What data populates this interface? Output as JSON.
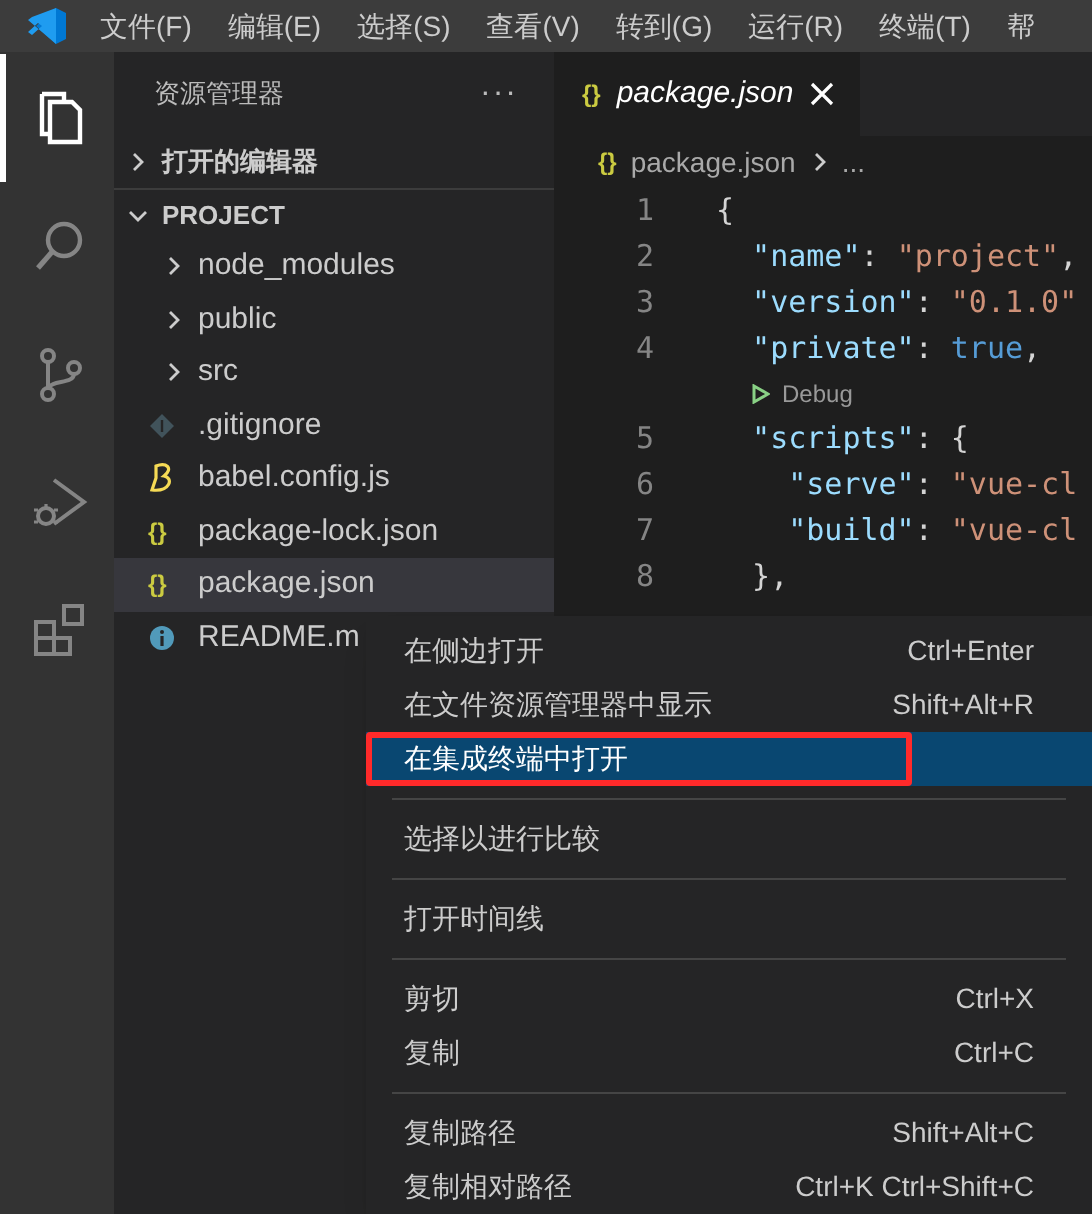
{
  "menu_bar": [
    {
      "label": "文件(F)"
    },
    {
      "label": "编辑(E)"
    },
    {
      "label": "选择(S)"
    },
    {
      "label": "查看(V)"
    },
    {
      "label": "转到(G)"
    },
    {
      "label": "运行(R)"
    },
    {
      "label": "终端(T)"
    },
    {
      "label": "帮"
    }
  ],
  "activity_bar": [
    {
      "kind": "files",
      "selected": true
    },
    {
      "kind": "search",
      "selected": false
    },
    {
      "kind": "source-control",
      "selected": false
    },
    {
      "kind": "run",
      "selected": false
    },
    {
      "kind": "extensions",
      "selected": false
    }
  ],
  "sidebar": {
    "title": "资源管理器",
    "more": "···",
    "sections": [
      {
        "label": "打开的编辑器",
        "expanded": false
      },
      {
        "label": "PROJECT",
        "expanded": true,
        "children": [
          {
            "kind": "folder",
            "label": "node_modules",
            "selected": false
          },
          {
            "kind": "folder",
            "label": "public",
            "selected": false
          },
          {
            "kind": "folder",
            "label": "src",
            "selected": false
          },
          {
            "kind": "git",
            "label": ".gitignore",
            "selected": false
          },
          {
            "kind": "babel",
            "label": "babel.config.js",
            "selected": false
          },
          {
            "kind": "json",
            "label": "package-lock.json",
            "selected": false
          },
          {
            "kind": "json",
            "label": "package.json",
            "selected": true
          },
          {
            "kind": "info",
            "label": "README.m",
            "selected": false
          }
        ]
      }
    ]
  },
  "editor": {
    "tab": {
      "label": "package.json",
      "icon": "{}"
    },
    "breadcrumb": {
      "icon": "{}",
      "file": "package.json",
      "more": "..."
    },
    "lines": [
      {
        "kind": "code",
        "number": "1",
        "tokens": [
          {
            "kind": "punct",
            "text": "{"
          }
        ]
      },
      {
        "kind": "code",
        "number": "2",
        "tokens": [
          {
            "kind": "key",
            "text": "  \"name\""
          },
          {
            "kind": "punct",
            "text": ": "
          },
          {
            "kind": "string",
            "text": "\"project\""
          },
          {
            "kind": "punct",
            "text": ","
          }
        ]
      },
      {
        "kind": "code",
        "number": "3",
        "tokens": [
          {
            "kind": "key",
            "text": "  \"version\""
          },
          {
            "kind": "punct",
            "text": ": "
          },
          {
            "kind": "string",
            "text": "\"0.1.0\""
          }
        ]
      },
      {
        "kind": "code",
        "number": "4",
        "tokens": [
          {
            "kind": "key",
            "text": "  \"private\""
          },
          {
            "kind": "punct",
            "text": ": "
          },
          {
            "kind": "keyword",
            "text": "true"
          },
          {
            "kind": "punct",
            "text": ","
          }
        ]
      },
      {
        "kind": "codelens",
        "text": "Debug"
      },
      {
        "kind": "code",
        "number": "5",
        "tokens": [
          {
            "kind": "key",
            "text": "  \"scripts\""
          },
          {
            "kind": "punct",
            "text": ": {"
          }
        ]
      },
      {
        "kind": "code",
        "number": "6",
        "tokens": [
          {
            "kind": "key",
            "text": "    \"serve\""
          },
          {
            "kind": "punct",
            "text": ": "
          },
          {
            "kind": "string",
            "text": "\"vue-cl"
          }
        ]
      },
      {
        "kind": "code",
        "number": "7",
        "tokens": [
          {
            "kind": "key",
            "text": "    \"build\""
          },
          {
            "kind": "punct",
            "text": ": "
          },
          {
            "kind": "string",
            "text": "\"vue-cl"
          }
        ]
      },
      {
        "kind": "code",
        "number": "8",
        "tokens": [
          {
            "kind": "punct",
            "text": "  },"
          }
        ]
      }
    ]
  },
  "context_menu": [
    {
      "kind": "item",
      "label": "在侧边打开",
      "shortcut": "Ctrl+Enter",
      "selected": false,
      "annotated": false
    },
    {
      "kind": "item",
      "label": "在文件资源管理器中显示",
      "shortcut": "Shift+Alt+R",
      "selected": false,
      "annotated": false
    },
    {
      "kind": "item",
      "label": "在集成终端中打开",
      "selected": true,
      "annotated": true
    },
    {
      "kind": "separator"
    },
    {
      "kind": "item",
      "label": "选择以进行比较",
      "selected": false,
      "annotated": false
    },
    {
      "kind": "separator"
    },
    {
      "kind": "item",
      "label": "打开时间线",
      "selected": false,
      "annotated": false
    },
    {
      "kind": "separator"
    },
    {
      "kind": "item",
      "label": "剪切",
      "shortcut": "Ctrl+X",
      "selected": false,
      "annotated": false
    },
    {
      "kind": "item",
      "label": "复制",
      "shortcut": "Ctrl+C",
      "selected": false,
      "annotated": false
    },
    {
      "kind": "separator"
    },
    {
      "kind": "item",
      "label": "复制路径",
      "shortcut": "Shift+Alt+C",
      "selected": false,
      "annotated": false
    },
    {
      "kind": "item",
      "label": "复制相对路径",
      "shortcut": "Ctrl+K Ctrl+Shift+C",
      "selected": false,
      "annotated": false
    }
  ]
}
